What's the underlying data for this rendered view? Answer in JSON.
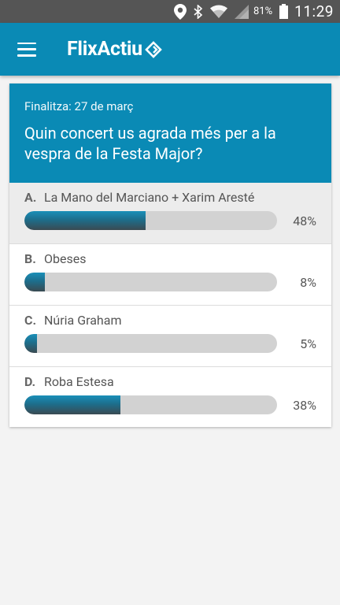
{
  "status_bar": {
    "battery": "81%",
    "time": "11:29",
    "icons": [
      "location-icon",
      "bluetooth-icon",
      "wifi-icon",
      "signal-icon",
      "battery-icon"
    ]
  },
  "app_bar": {
    "brand": "FlixActiu",
    "color": "#0a8ab5"
  },
  "poll": {
    "deadline": "Finalitza: 27 de març",
    "question": "Quin concert us agrada més per a la vespra de la Festa Major?",
    "options": [
      {
        "letter": "A.",
        "label": "La Mano del Marciano + Xarim Aresté",
        "percent": "48%",
        "value": 0.48
      },
      {
        "letter": "B.",
        "label": "Obeses",
        "percent": "8%",
        "value": 0.08
      },
      {
        "letter": "C.",
        "label": "Núria Graham",
        "percent": "5%",
        "value": 0.05
      },
      {
        "letter": "D.",
        "label": "Roba Estesa",
        "percent": "38%",
        "value": 0.38
      }
    ]
  }
}
